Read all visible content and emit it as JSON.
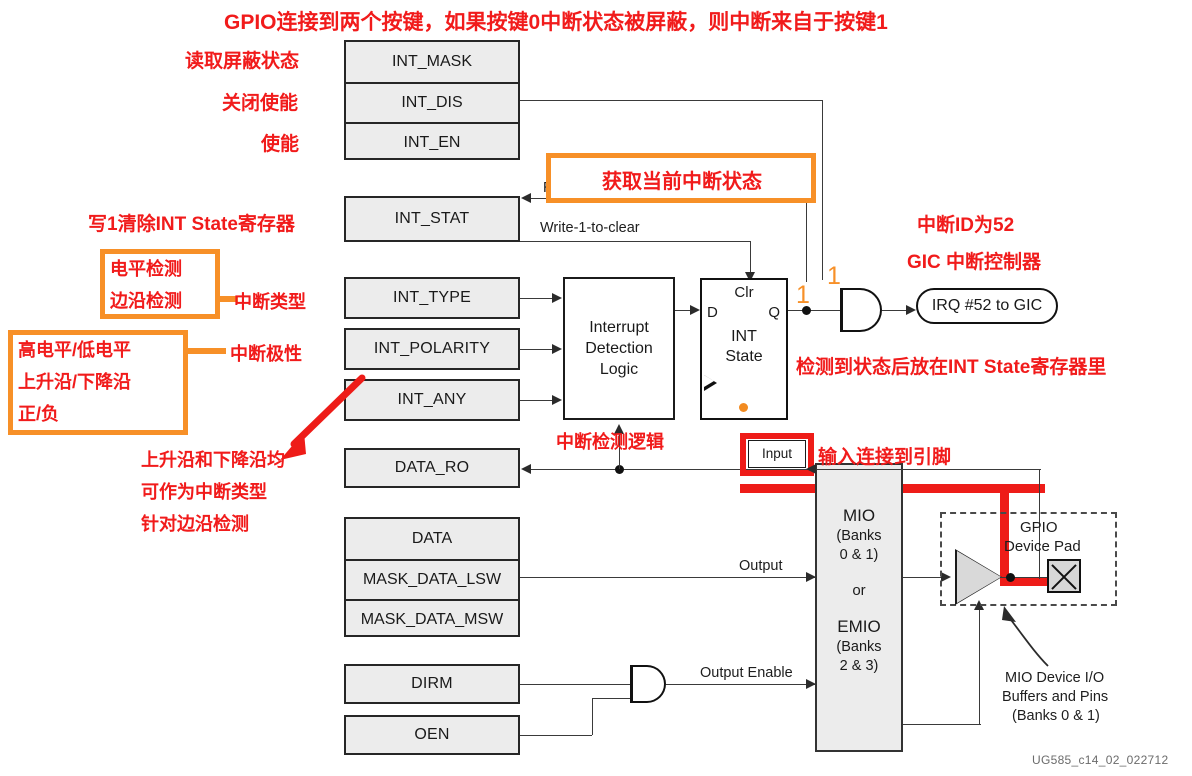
{
  "diagram": {
    "title_annotation": "GPIO连接到两个按键，如果按键0中断状态被屏蔽，则中断来自于按键1",
    "watermark": "UG585_c14_02_022712"
  },
  "registers": {
    "mask_group": [
      {
        "name": "INT_MASK"
      },
      {
        "name": "INT_DIS"
      },
      {
        "name": "INT_EN"
      }
    ],
    "int_stat": "INT_STAT",
    "int_type": "INT_TYPE",
    "int_polarity": "INT_POLARITY",
    "int_any": "INT_ANY",
    "data_ro": "DATA_RO",
    "data_group": [
      {
        "name": "DATA"
      },
      {
        "name": "MASK_DATA_LSW"
      },
      {
        "name": "MASK_DATA_MSW"
      }
    ],
    "dirm": "DIRM",
    "oen": "OEN"
  },
  "blocks": {
    "detect_logic": {
      "line1": "Interrupt",
      "line2": "Detection",
      "line3": "Logic"
    },
    "int_state": {
      "clr": "Clr",
      "d": "D",
      "q": "Q",
      "line1": "INT",
      "line2": "State"
    },
    "irq": "IRQ #52 to GIC",
    "input_tap": "Input",
    "mio": {
      "l1": "MIO",
      "l2": "(Banks",
      "l3": "0 & 1)",
      "l4": "or",
      "l5": "EMIO",
      "l6": "(Banks",
      "l7": "2 & 3)"
    },
    "gpio_pad": {
      "l1": "GPIO",
      "l2": "Device Pad"
    },
    "mio_buffers": {
      "l1": "MIO Device I/O",
      "l2": "Buffers and Pins",
      "l3": "(Banks 0 & 1)"
    }
  },
  "wire_labels": {
    "read": "Read",
    "write_1_to_clear": "Write-1-to-clear",
    "output": "Output",
    "output_enable": "Output Enable"
  },
  "signal_values": {
    "q_one": "1",
    "en_one": "1"
  },
  "annotations": {
    "read_mask_state": "读取屏蔽状态",
    "disable_enable": "关闭使能",
    "enable": "使能",
    "write1_clear_int_state": "写1清除INT State寄存器",
    "get_current_int_state": "获取当前中断状态",
    "int_id_52": "中断ID为52",
    "gic_controller": "GIC 中断控制器",
    "state_stored_in_int_state": "检测到状态后放在INT State寄存器里",
    "level_detect": "电平检测",
    "edge_detect": "边沿检测",
    "int_type": "中断类型",
    "high_low_level": "高电平/低电平",
    "rise_fall_edge": "上升沿/下降沿",
    "pos_neg": "正/负",
    "int_polarity": "中断极性",
    "both_edges_l1": "上升沿和下降沿均",
    "both_edges_l2": "可作为中断类型",
    "both_edges_l3": "针对边沿检测",
    "int_detect_logic": "中断检测逻辑",
    "input_to_pin": "输入连接到引脚"
  },
  "colors": {
    "red_annotation": "#f11b1b",
    "orange_callout": "#f79028",
    "red_highlight": "#ee1c18",
    "register_fill": "#ececec",
    "wire": "#2b2b2b"
  }
}
